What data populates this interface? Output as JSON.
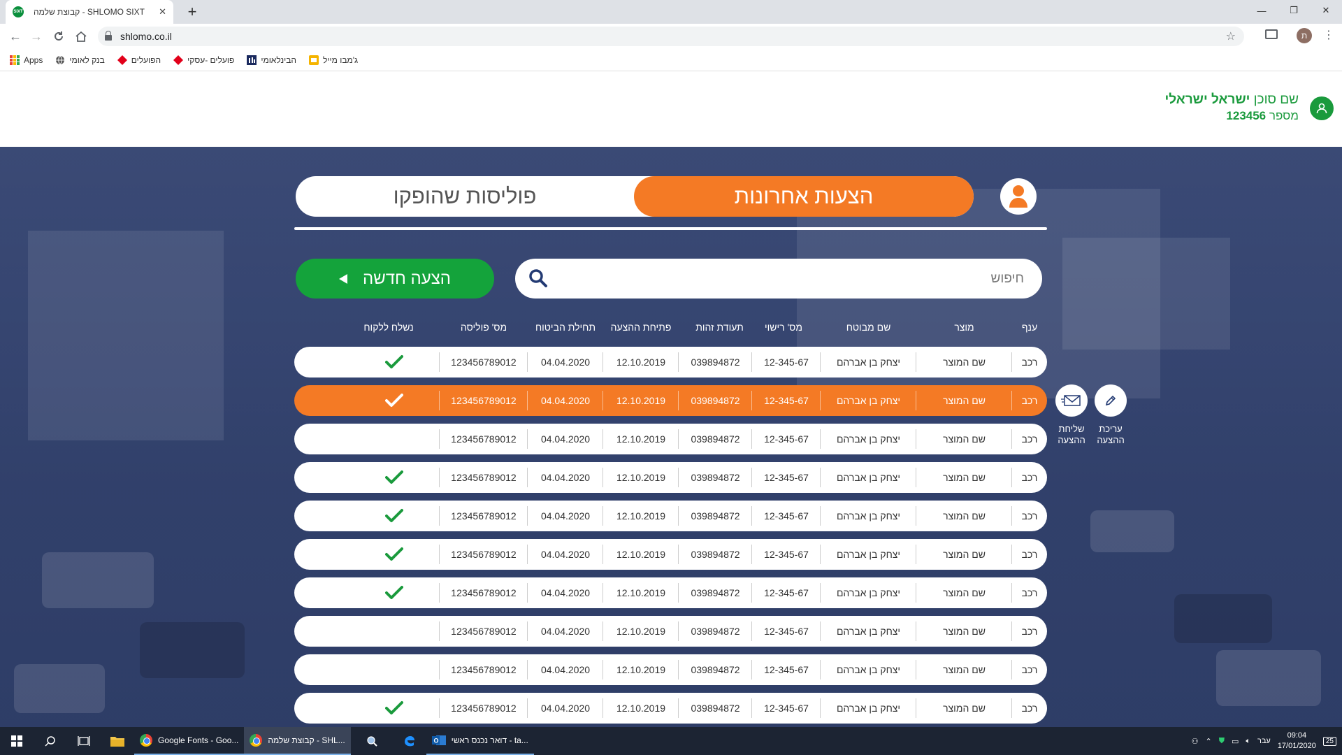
{
  "browser": {
    "tab_title": "קבוצת שלמה - SHLOMO SIXT",
    "favicon_text": "SIXT",
    "new_tab": "+",
    "url": "shlomo.co.il",
    "profile_initial": "ת",
    "window_controls": {
      "minimize": "—",
      "restore": "❐",
      "close": "✕"
    },
    "bookmarks": [
      {
        "label": "Apps",
        "icon": "apps-grid-icon"
      },
      {
        "label": "בנק לאומי",
        "icon": "globe-icon"
      },
      {
        "label": "הפועלים",
        "icon": "red-diamond-icon"
      },
      {
        "label": "פועלים -עסקי",
        "icon": "red-diamond-icon"
      },
      {
        "label": "הבינלאומי",
        "icon": "fibi-icon"
      },
      {
        "label": "ג'מבו מייל",
        "icon": "jumbo-icon"
      }
    ]
  },
  "header": {
    "agent_prefix": "שם סוכן",
    "agent_name": "ישראל ישראלי",
    "number_prefix": "מספר",
    "agent_number": "123456"
  },
  "tabs": {
    "active": "הצעות אחרונות",
    "inactive": "פוליסות שהופקו"
  },
  "new_offer_label": "הצעה חדשה",
  "search": {
    "placeholder": "חיפוש",
    "value": ""
  },
  "columns": [
    "ענף",
    "מוצר",
    "שם מבוטח",
    "מס' רישוי",
    "תעודת זהות",
    "פתיחת ההצעה",
    "תחילת הביטוח",
    "מס' פוליסה",
    "נשלח ללקוח"
  ],
  "rows": [
    {
      "branch": "רכב",
      "product": "שם המוצר",
      "insured": "יצחק בן אברהם",
      "license": "12-345-67",
      "id": "039894872",
      "opened": "12.10.2019",
      "start": "04.04.2020",
      "policy": "123456789012",
      "sent": true,
      "selected": false
    },
    {
      "branch": "רכב",
      "product": "שם המוצר",
      "insured": "יצחק בן אברהם",
      "license": "12-345-67",
      "id": "039894872",
      "opened": "12.10.2019",
      "start": "04.04.2020",
      "policy": "123456789012",
      "sent": true,
      "selected": true
    },
    {
      "branch": "רכב",
      "product": "שם המוצר",
      "insured": "יצחק בן אברהם",
      "license": "12-345-67",
      "id": "039894872",
      "opened": "12.10.2019",
      "start": "04.04.2020",
      "policy": "123456789012",
      "sent": false,
      "selected": false
    },
    {
      "branch": "רכב",
      "product": "שם המוצר",
      "insured": "יצחק בן אברהם",
      "license": "12-345-67",
      "id": "039894872",
      "opened": "12.10.2019",
      "start": "04.04.2020",
      "policy": "123456789012",
      "sent": true,
      "selected": false
    },
    {
      "branch": "רכב",
      "product": "שם המוצר",
      "insured": "יצחק בן אברהם",
      "license": "12-345-67",
      "id": "039894872",
      "opened": "12.10.2019",
      "start": "04.04.2020",
      "policy": "123456789012",
      "sent": true,
      "selected": false
    },
    {
      "branch": "רכב",
      "product": "שם המוצר",
      "insured": "יצחק בן אברהם",
      "license": "12-345-67",
      "id": "039894872",
      "opened": "12.10.2019",
      "start": "04.04.2020",
      "policy": "123456789012",
      "sent": true,
      "selected": false
    },
    {
      "branch": "רכב",
      "product": "שם המוצר",
      "insured": "יצחק בן אברהם",
      "license": "12-345-67",
      "id": "039894872",
      "opened": "12.10.2019",
      "start": "04.04.2020",
      "policy": "123456789012",
      "sent": true,
      "selected": false
    },
    {
      "branch": "רכב",
      "product": "שם המוצר",
      "insured": "יצחק בן אברהם",
      "license": "12-345-67",
      "id": "039894872",
      "opened": "12.10.2019",
      "start": "04.04.2020",
      "policy": "123456789012",
      "sent": false,
      "selected": false
    },
    {
      "branch": "רכב",
      "product": "שם המוצר",
      "insured": "יצחק בן אברהם",
      "license": "12-345-67",
      "id": "039894872",
      "opened": "12.10.2019",
      "start": "04.04.2020",
      "policy": "123456789012",
      "sent": false,
      "selected": false
    },
    {
      "branch": "רכב",
      "product": "שם המוצר",
      "insured": "יצחק בן אברהם",
      "license": "12-345-67",
      "id": "039894872",
      "opened": "12.10.2019",
      "start": "04.04.2020",
      "policy": "123456789012",
      "sent": true,
      "selected": false
    }
  ],
  "actions": {
    "edit": "עריכת ההצעה",
    "send": "שליחת ההצעה"
  },
  "colors": {
    "accent_orange": "#f47a25",
    "brand_green": "#14a33b",
    "check_green": "#1a9a3c"
  },
  "taskbar": {
    "apps": [
      {
        "label": "Google Fonts - Goo...",
        "icon": "chrome-icon",
        "active": false
      },
      {
        "label": "קבוצת שלמה - SHL...",
        "icon": "chrome-icon",
        "active": true
      },
      {
        "label": "דואר נכנס ראשי - ta...",
        "icon": "outlook-icon",
        "active": false
      }
    ],
    "language": "עבר",
    "time": "09:04",
    "date": "17/01/2020",
    "notifications": "25"
  }
}
